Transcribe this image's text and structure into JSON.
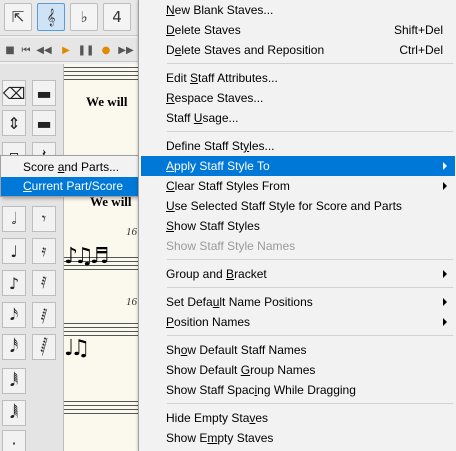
{
  "toolbar": {
    "buttons": [
      {
        "icon": "selection-tool-icon"
      },
      {
        "icon": "staff-tool-icon",
        "active": true
      },
      {
        "icon": "key-signature-icon"
      },
      {
        "icon": "time-signature-icon"
      }
    ]
  },
  "playback": {
    "buttons": [
      {
        "icon": "stop-icon"
      },
      {
        "icon": "rewind-start-icon"
      },
      {
        "icon": "rewind-icon"
      },
      {
        "icon": "play-icon"
      },
      {
        "icon": "pause-icon"
      },
      {
        "icon": "record-icon"
      },
      {
        "icon": "fast-forward-icon"
      }
    ]
  },
  "score": {
    "lyric_1": "We will",
    "lyric_2": "We will",
    "measure_1": "16",
    "measure_2": "16"
  },
  "submenu": {
    "items": [
      {
        "pre": "Score ",
        "key": "a",
        "post": "nd Parts..."
      },
      {
        "pre": "",
        "key": "C",
        "post": "urrent Part/Score",
        "highlight": true
      }
    ]
  },
  "menu": {
    "items": [
      {
        "pre": "",
        "key": "N",
        "post": "ew Blank Staves...",
        "shortcut": ""
      },
      {
        "pre": "",
        "key": "D",
        "post": "elete Staves",
        "shortcut": "Shift+Del"
      },
      {
        "pre": "D",
        "key": "e",
        "post": "lete Staves and Reposition",
        "shortcut": "Ctrl+Del"
      },
      {
        "pre": "Edit ",
        "key": "S",
        "post": "taff Attributes...",
        "shortcut": ""
      },
      {
        "pre": "",
        "key": "R",
        "post": "espace Staves...",
        "shortcut": ""
      },
      {
        "pre": "Staff ",
        "key": "U",
        "post": "sage...",
        "shortcut": ""
      },
      {
        "pre": "Define Staff St",
        "key": "y",
        "post": "les...",
        "shortcut": ""
      },
      {
        "pre": "",
        "key": "A",
        "post": "pply Staff Style To",
        "shortcut": "",
        "submenu": true,
        "highlight": true
      },
      {
        "pre": "",
        "key": "C",
        "post": "lear Staff Styles From",
        "shortcut": "",
        "submenu": true
      },
      {
        "pre": "",
        "key": "U",
        "post": "se Selected Staff Style for Score and Parts",
        "shortcut": ""
      },
      {
        "pre": "",
        "key": "S",
        "post": "how Staff Styles",
        "shortcut": ""
      },
      {
        "pre": "Show Staff Style Names",
        "key": "",
        "post": "",
        "shortcut": "",
        "disabled": true
      },
      {
        "pre": "Group and ",
        "key": "B",
        "post": "racket",
        "shortcut": "",
        "submenu": true
      },
      {
        "pre": "Set Defa",
        "key": "u",
        "post": "lt Name Positions",
        "shortcut": "",
        "submenu": true
      },
      {
        "pre": "",
        "key": "P",
        "post": "osition Names",
        "shortcut": "",
        "submenu": true
      },
      {
        "pre": "Sh",
        "key": "o",
        "post": "w Default Staff Names",
        "shortcut": ""
      },
      {
        "pre": "Show Default ",
        "key": "G",
        "post": "roup Names",
        "shortcut": ""
      },
      {
        "pre": "Show Staff Spac",
        "key": "i",
        "post": "ng While Dragging",
        "shortcut": ""
      },
      {
        "pre": "Hide Empty Sta",
        "key": "v",
        "post": "es",
        "shortcut": ""
      },
      {
        "pre": "Show E",
        "key": "m",
        "post": "pty Staves",
        "shortcut": ""
      }
    ]
  },
  "colors": {
    "highlight": "#0078d7",
    "menu_bg": "#f2f2f2",
    "disabled_text": "#9a9a9a",
    "score_paper": "#fbf8ee"
  }
}
